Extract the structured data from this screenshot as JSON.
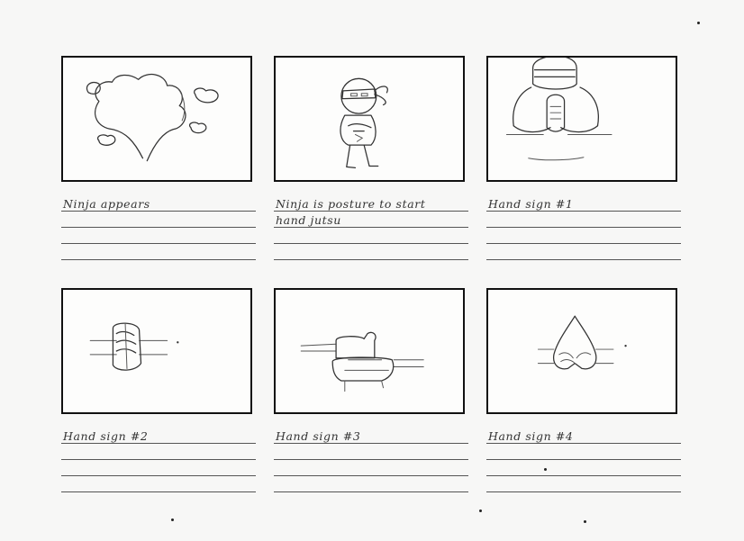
{
  "storyboard": {
    "frames": [
      {
        "caption": "Ninja appears",
        "drawing": "smoke-cloud"
      },
      {
        "caption": "Ninja is posture to start",
        "caption_line2": "hand jutsu",
        "drawing": "ninja-full-body"
      },
      {
        "caption": "Hand sign #1",
        "drawing": "ninja-hands-clasped"
      },
      {
        "caption": "Hand sign #2",
        "drawing": "hand-sign-interlaced"
      },
      {
        "caption": "Hand sign #3",
        "drawing": "hand-sign-stacked"
      },
      {
        "caption": "Hand sign #4",
        "drawing": "hand-sign-steeple"
      }
    ]
  }
}
